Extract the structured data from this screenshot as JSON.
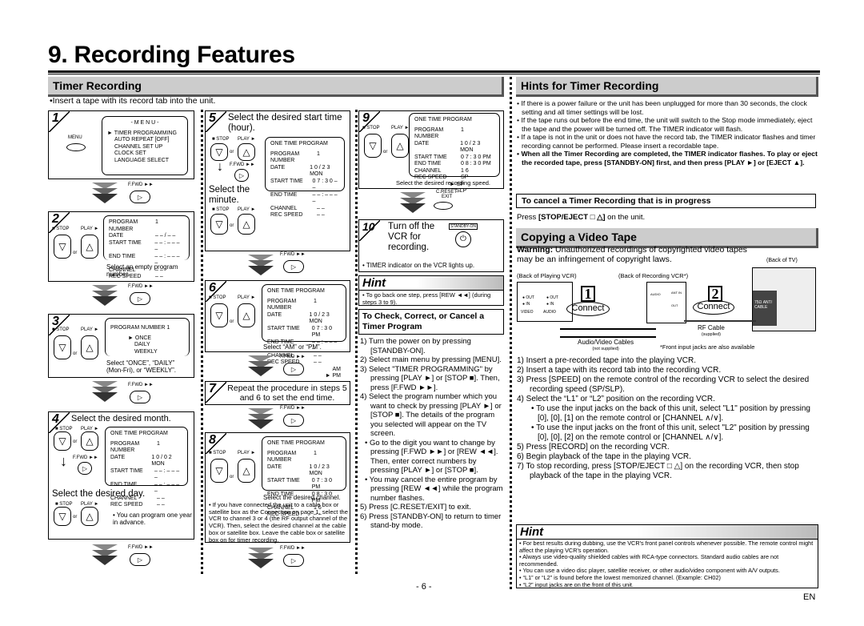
{
  "page": {
    "title": "9. Recording Features",
    "page_number": "- 6 -",
    "language_tag": "EN"
  },
  "timer_recording": {
    "heading": "Timer Recording",
    "intro": "•Insert a tape with its record tab into the unit.",
    "labels": {
      "stop": "■ STOP",
      "play": "PLAY ►",
      "or": "or",
      "fwd": "F.FWD ►►",
      "menu": "MENU",
      "creset": "C.RESET",
      "exit": "EXIT",
      "standby": "STANDBY-ON",
      "one_time_program": "ONE TIME PROGRAM"
    },
    "steps": [
      {
        "num": "1",
        "menu_title": "- M E N U -",
        "menu_items": [
          "► TIMER PROGRAMMING",
          "AUTO REPEAT  [OFF]",
          "CHANNEL SET UP",
          "CLOCK SET",
          "LANGUAGE SELECT"
        ]
      },
      {
        "num": "2",
        "rows": [
          [
            "PROGRAM NUMBER",
            "1"
          ],
          [
            "DATE",
            "– – / – –"
          ],
          [
            "START TIME",
            "– – : – –  – –"
          ],
          [
            "END   TIME",
            "– – : – –  – –"
          ],
          [
            "CHANNEL",
            "– –"
          ],
          [
            "REC SPEED",
            "– –"
          ]
        ],
        "caption": "Select an empty program number."
      },
      {
        "num": "3",
        "header": "PROGRAM  NUMBER  1",
        "options": [
          "► ONCE",
          "DAILY",
          "WEEKLY"
        ],
        "caption": "Select “ONCE”, “DAILY” (Mon-Fri), or “WEEKLY”."
      },
      {
        "num": "4",
        "heading": "Select the desired month.",
        "rows": [
          [
            "PROGRAM NUMBER",
            "1"
          ],
          [
            "DATE",
            "1 0 / 0 2   MON"
          ],
          [
            "START TIME",
            "– – : – –  – –"
          ],
          [
            "END   TIME",
            "– – : – –  – –"
          ],
          [
            "CHANNEL",
            "– –"
          ],
          [
            "REC SPEED",
            "– –"
          ]
        ],
        "subheading": "Select the desired day.",
        "note": "• You can program one year in advance."
      },
      {
        "num": "5",
        "heading": "Select the desired start time (hour).",
        "rows": [
          [
            "PROGRAM NUMBER",
            "1"
          ],
          [
            "DATE",
            "1 0 / 2 3   MON"
          ],
          [
            "START TIME",
            "0 7 : 3 0  – –"
          ],
          [
            "END   TIME",
            "– – : – –  – –"
          ],
          [
            "CHANNEL",
            "– –"
          ],
          [
            "REC SPEED",
            "– –"
          ]
        ],
        "subheading": "Select the minute."
      },
      {
        "num": "6",
        "rows": [
          [
            "PROGRAM NUMBER",
            "1"
          ],
          [
            "DATE",
            "1 0 / 2 3   MON"
          ],
          [
            "START TIME",
            "0 7 : 3 0   PM"
          ],
          [
            "END   TIME",
            "– – : – –  – –"
          ],
          [
            "CHANNEL",
            "– –"
          ],
          [
            "REC SPEED",
            "– –"
          ]
        ],
        "options": [
          "AM",
          "► PM"
        ],
        "caption": "Select “AM” or “PM”."
      },
      {
        "num": "7",
        "heading": "Repeat the procedure in steps 5 and 6 to set the end time."
      },
      {
        "num": "8",
        "rows": [
          [
            "PROGRAM NUMBER",
            "1"
          ],
          [
            "DATE",
            "1 0 / 2 3   MON"
          ],
          [
            "START TIME",
            "0 7 : 3 0    PM"
          ],
          [
            "END   TIME",
            "0 8 : 3 0    PM"
          ],
          [
            "CHANNEL",
            "1 6"
          ],
          [
            "REC SPEED",
            "– –"
          ]
        ],
        "caption": "Select the desired channel.",
        "note": "• If you have connected the unit to a cable box or satellite box as the Connection on page 1, select the VCR to channel 3 or 4 (the RF output channel of the VCR). Then, select the desired channel at the cable box or satellite box. Leave the cable box or satellite box on for timer recording."
      },
      {
        "num": "9",
        "rows": [
          [
            "PROGRAM NUMBER",
            "1"
          ],
          [
            "DATE",
            "1 0 / 2 3   MON"
          ],
          [
            "START TIME",
            "0 7 : 3 0    PM"
          ],
          [
            "END   TIME",
            "0 8 : 3 0    PM"
          ],
          [
            "CHANNEL",
            "1 6"
          ],
          [
            "REC SPEED",
            "SP"
          ]
        ],
        "options": [
          "► SP",
          "SLP"
        ],
        "caption": "Select the desired recording speed."
      },
      {
        "num": "10",
        "heading": "Turn off the VCR for recording.",
        "note": "• TIMER indicator on the VCR lights up."
      }
    ],
    "hint": {
      "heading": "Hint",
      "text": "• To go back one step, press [REW ◄◄] (during steps 3 to 9)."
    },
    "check": {
      "heading": "To Check, Correct, or Cancel a Timer Program",
      "items": [
        "1) Turn the power on by pressing [STANDBY-ON].",
        "2) Select main menu by pressing [MENU].",
        "3) Select \"TIMER PROGRAMMING\" by pressing [PLAY ►] or [STOP ■]. Then, press [F.FWD ►►].",
        "4) Select the program number which you want to check by pressing [PLAY ►] or [STOP ■]. The details of the program you selected will appear on the TV screen.",
        "• Go to the digit you want to change by pressing [F.FWD ►►] or [REW ◄◄]. Then, enter correct numbers by pressing [PLAY ►] or [STOP ■].",
        "• You may cancel the entire program by pressing [REW ◄◄] while the program number flashes.",
        "5) Press [C.RESET/EXIT] to exit.",
        "6) Press [STANDBY-ON] to return to timer stand-by mode."
      ]
    }
  },
  "hints_timer": {
    "heading": "Hints for Timer Recording",
    "items": [
      "• If there is a power failure or the unit has been unplugged for more than 30 seconds, the clock setting and all timer settings will be lost.",
      "• If the tape runs out before the end time, the unit will switch to the Stop mode immediately, eject the tape and the power will be turned off. The TIMER indicator will flash.",
      "• If a tape is not in the unit or does not have the record tab, the TIMER indicator flashes and timer recording cannot be performed. Please insert a recordable tape."
    ],
    "bold_item": "• When all the Timer Recording are completed, the TIMER indicator flashes. To play or eject the recorded tape, press [STANDBY-ON] first, and then press [PLAY ►] or [EJECT ▲]."
  },
  "cancel": {
    "heading": "To cancel a Timer Recording that is in progress",
    "text_prefix": "Press ",
    "text_bold": "[STOP/EJECT □ △]",
    "text_suffix": " on the unit."
  },
  "copying": {
    "heading": "Copying a Video Tape",
    "warning_label": "Warning:",
    "warning_text": " Unauthorized recordings of copyrighted video tapes may be an infringement of copyright laws.",
    "diagram": {
      "back_playing": "(Back of Playing VCR)",
      "back_recording": "(Back of Recording VCR*)",
      "back_tv": "(Back of TV)",
      "connect1_num": "1",
      "connect2_num": "2",
      "connect_label": "Connect",
      "video": "VIDEO",
      "audio": "AUDIO",
      "out": "OUT",
      "in": "IN",
      "ant_in": "ANT IN",
      "ant_out": "OUT",
      "tv_jack": "75Ω ANT/ CABLE",
      "av_cables": "Audio/Video Cables",
      "av_cables_note": "(not supplied)",
      "rf_cable": "RF Cable",
      "rf_cable_note": "(supplied)",
      "front_note": "*Front input jacks are also available"
    },
    "steps": [
      "1)  Insert a pre-recorded tape into the playing VCR.",
      "2)  Insert a tape with its record tab into the recording VCR.",
      "3)  Press [SPEED] on the remote control of the recording VCR to select the desired recording speed (SP/SLP).",
      "4)  Select the “L1” or “L2” position on the recording VCR.",
      "• To use the input jacks on the back of this unit, select \"L1\" position by pressing [0], [0], [1] on the remote control or [CHANNEL ∧/∨].",
      "• To use the input jacks on the front of this unit, select \"L2\" position by pressing [0], [0], [2] on the remote control or [CHANNEL ∧/∨].",
      "5)  Press [RECORD] on the recording VCR.",
      "6)  Begin playback of the tape in the playing VCR.",
      "7)  To stop recording, press [STOP/EJECT □ △] on the recording VCR, then stop playback of the tape in the playing VCR."
    ],
    "hint": {
      "heading": "Hint",
      "items": [
        "• For best results during dubbing, use the VCR's front panel controls whenever possible. The remote control might affect the playing VCR's operation.",
        "• Always use video-quality shielded cables with RCA-type connectors. Standard audio cables are not recommended.",
        "• You can use a video disc player, satellite receiver, or other audio/video component with A/V outputs.",
        "• “L1” or “L2” is found before the lowest memorized channel. (Example: CH02)",
        "• “L2” input jacks are on the front of this unit."
      ]
    }
  }
}
